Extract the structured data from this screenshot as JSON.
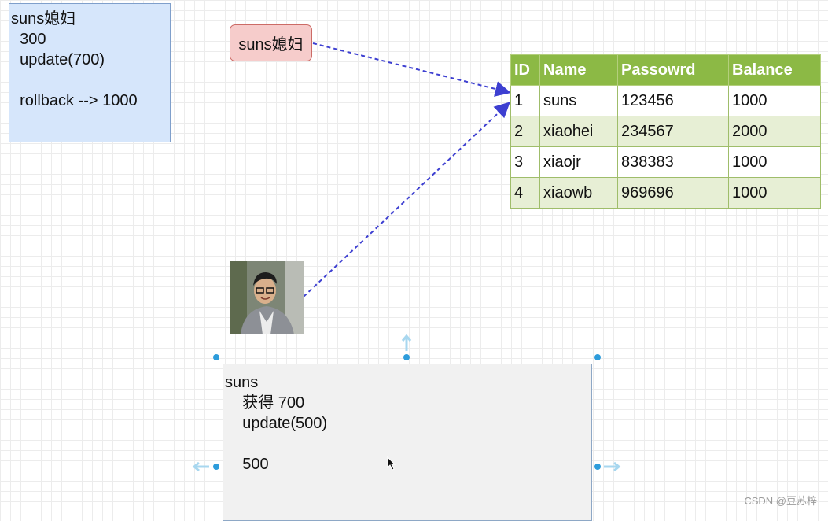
{
  "blue_note": {
    "lines": [
      "suns媳妇",
      "  300",
      "  update(700)",
      "",
      "  rollback --> 1000"
    ]
  },
  "pink_label": "suns媳妇",
  "table": {
    "headers": [
      "ID",
      "Name",
      "Passowrd",
      "Balance"
    ],
    "rows": [
      [
        "1",
        "suns",
        "123456",
        "1000"
      ],
      [
        "2",
        "xiaohei",
        "234567",
        "2000"
      ],
      [
        "3",
        "xiaojr",
        "838383",
        "1000"
      ],
      [
        "4",
        "xiaowb",
        "969696",
        "1000"
      ]
    ],
    "header_color": "#8cb945"
  },
  "gray_note": {
    "lines": [
      "suns",
      "    获得 700",
      "    update(500)",
      "",
      "    500"
    ]
  },
  "watermark": "CSDN @豆苏梓",
  "colors": {
    "arrow": "#3d3fd1",
    "handle": "#2d9cdb"
  }
}
